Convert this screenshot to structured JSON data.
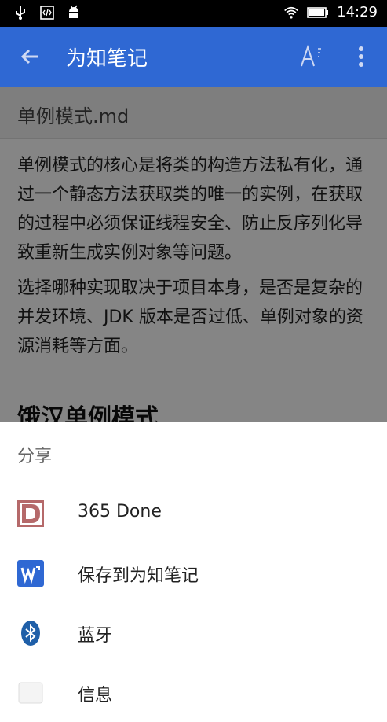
{
  "status_bar": {
    "time": "14:29",
    "left_icons": [
      "usb-icon",
      "code-icon",
      "android-icon"
    ],
    "right_icons": [
      "wifi-icon",
      "battery-icon"
    ]
  },
  "app_bar": {
    "title": "为知笔记",
    "color": "#2f68d3",
    "back_icon": "arrow-back-icon",
    "font_icon": "font-size-icon",
    "menu_icon": "more-vert-icon"
  },
  "note": {
    "filename": "单例模式.md",
    "paragraphs": [
      "单例模式的核心是将类的构造方法私有化，通过一个静态方法获取类的唯一的实例，在获取的过程中必须保证线程安全、防止反序列化导致重新生成实例对象等问题。",
      "选择哪种实现取决于项目本身，是否是复杂的并发环境、JDK 版本是否过低、单例对象的资源消耗等方面。"
    ],
    "heading": "饿汉单例模式"
  },
  "share_sheet": {
    "title": "分享",
    "items": [
      {
        "label": "365 Done",
        "icon": "365-done-icon"
      },
      {
        "label": "保存到为知笔记",
        "icon": "wiz-note-icon"
      },
      {
        "label": "蓝牙",
        "icon": "bluetooth-icon"
      },
      {
        "label": "信息",
        "icon": "message-icon"
      }
    ]
  }
}
